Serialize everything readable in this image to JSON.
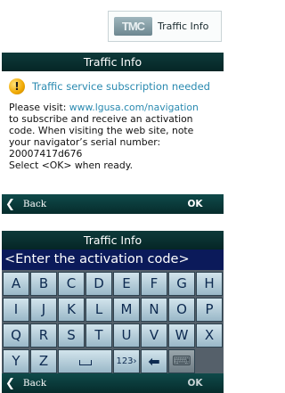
{
  "tmc_button": {
    "logo_text": "TMC",
    "label": "Traffic Info"
  },
  "screen1": {
    "title": "Traffic Info",
    "warning_icon": "exclamation-icon",
    "message_title": "Traffic service subscription needed",
    "body_lines": [
      "Please visit: ",
      "www.lgusa.com/navigation",
      "to subscribe and receive an activation",
      "code. When visiting the web site, note",
      "your navigator’s serial number:",
      "20007417d676",
      "Select <OK> when ready."
    ],
    "back_label": "Back",
    "ok_label": "OK"
  },
  "screen2": {
    "title": "Traffic Info",
    "input_value": "<Enter the activation code>",
    "keyboard": {
      "row1": [
        "A",
        "B",
        "C",
        "D",
        "E",
        "F",
        "G",
        "H"
      ],
      "row2": [
        "I",
        "J",
        "K",
        "L",
        "M",
        "N",
        "O",
        "P"
      ],
      "row3": [
        "Q",
        "R",
        "S",
        "T",
        "U",
        "V",
        "W",
        "X"
      ],
      "row4": [
        "Y",
        "Z",
        "space",
        "123›",
        "backspace",
        "keyboard"
      ]
    },
    "mode_key_label": "123›",
    "back_label": "Back",
    "ok_label": "OK"
  },
  "colors": {
    "title_bar": "#0a3232",
    "input_bar": "#0b1a5a",
    "link": "#2a8ab0",
    "key": "#bcd4e0"
  }
}
